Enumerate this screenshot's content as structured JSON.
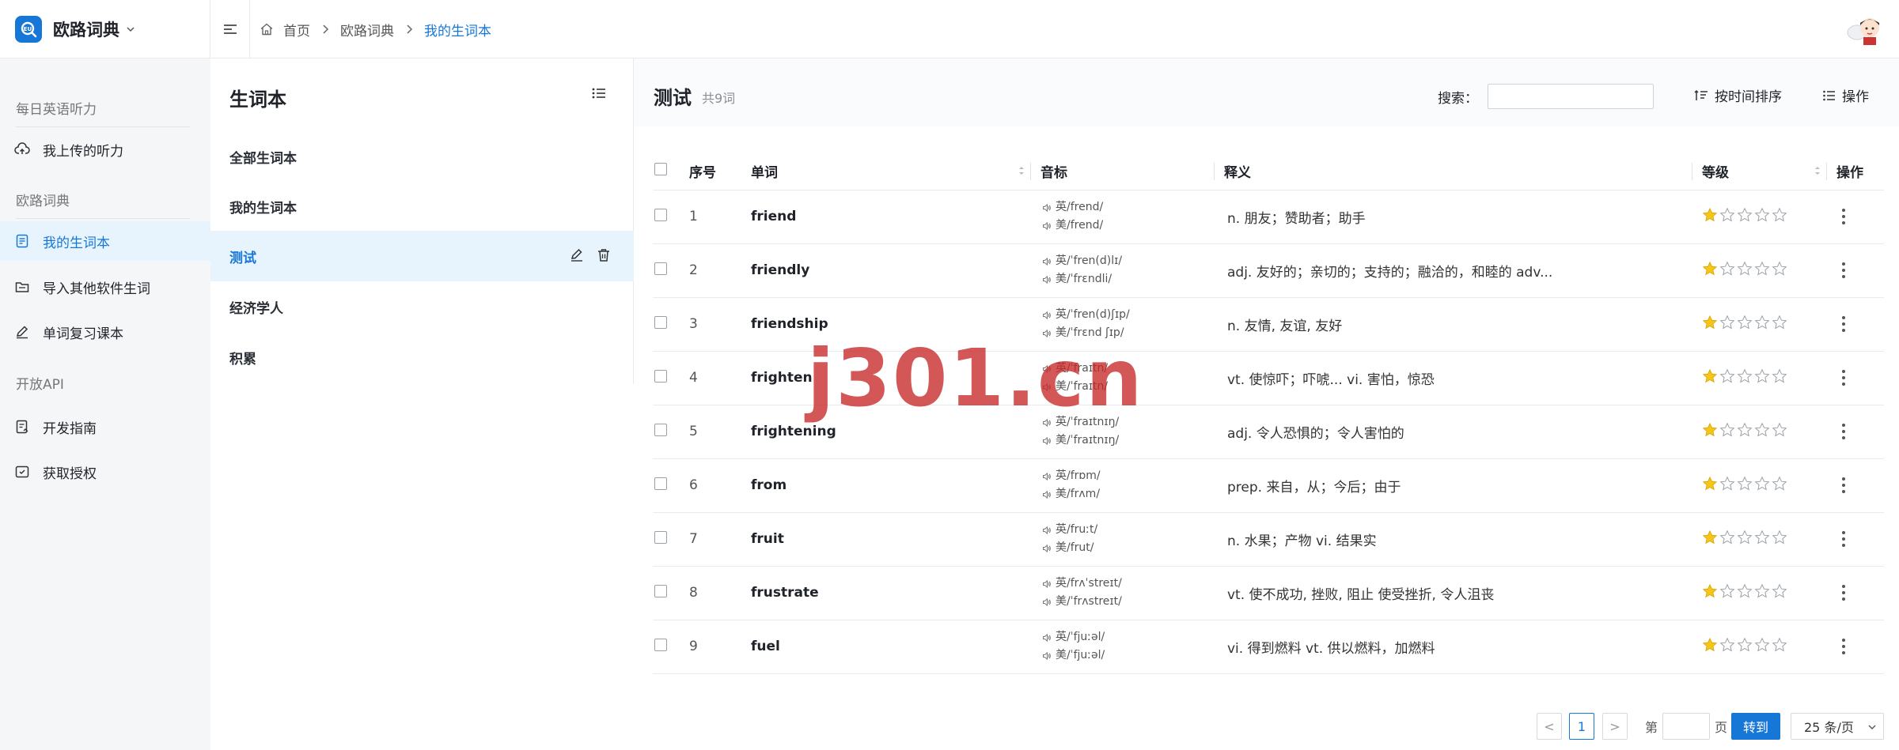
{
  "app": {
    "name": "欧路词典",
    "breadcrumb": [
      "首页",
      "欧路词典",
      "我的生词本"
    ]
  },
  "sidebar": {
    "groups": [
      {
        "title": "每日英语听力",
        "items": [
          {
            "label": "我上传的听力",
            "icon": "cloud-upload-icon"
          }
        ]
      },
      {
        "title": "欧路词典",
        "items": [
          {
            "label": "我的生词本",
            "icon": "notebook-icon",
            "active": true
          },
          {
            "label": "导入其他软件生词",
            "icon": "folder-icon"
          },
          {
            "label": "单词复习课本",
            "icon": "pencil-icon"
          }
        ]
      },
      {
        "title": "开放API",
        "items": [
          {
            "label": "开发指南",
            "icon": "doc-icon"
          },
          {
            "label": "获取授权",
            "icon": "auth-icon"
          }
        ]
      }
    ]
  },
  "notebooks": {
    "title": "生词本",
    "items": [
      "全部生词本",
      "我的生词本",
      "测试",
      "经济学人",
      "积累"
    ],
    "active_index": 2
  },
  "main": {
    "title": "测试",
    "count": "共9词",
    "search_label": "搜索：",
    "search_placeholder": "",
    "sort_label": "按时间排序",
    "ops_label": "操作",
    "columns": [
      "序号",
      "单词",
      "音标",
      "释义",
      "等级",
      "操作"
    ],
    "rows": [
      {
        "idx": "1",
        "word": "friend",
        "uk": "英/frend/",
        "us": "美/frend/",
        "def": "n. 朋友；赞助者；助手",
        "stars": 1
      },
      {
        "idx": "2",
        "word": "friendly",
        "uk": "英/ˈfren(d)lɪ/",
        "us": "美/ˈfrɛndli/",
        "def": "adj. 友好的；亲切的；支持的；融洽的，和睦的 adv...",
        "stars": 1
      },
      {
        "idx": "3",
        "word": "friendship",
        "uk": "英/ˈfren(d)ʃɪp/",
        "us": "美/ˈfrɛnd ʃɪp/",
        "def": "n. 友情, 友谊, 友好",
        "stars": 1
      },
      {
        "idx": "4",
        "word": "frighten",
        "uk": "英/ˈfraɪtn/",
        "us": "美/ˈfraɪtn/",
        "def": "vt. 使惊吓；吓唬... vi. 害怕，惊恐",
        "stars": 1
      },
      {
        "idx": "5",
        "word": "frightening",
        "uk": "英/ˈfraɪtnɪŋ/",
        "us": "美/ˈfraɪtnɪŋ/",
        "def": "adj. 令人恐惧的；令人害怕的",
        "stars": 1
      },
      {
        "idx": "6",
        "word": "from",
        "uk": "英/frɒm/",
        "us": "美/frʌm/",
        "def": "prep. 来自，从；今后；由于",
        "stars": 1
      },
      {
        "idx": "7",
        "word": "fruit",
        "uk": "英/fruːt/",
        "us": "美/frut/",
        "def": "n. 水果；产物 vi. 结果实",
        "stars": 1
      },
      {
        "idx": "8",
        "word": "frustrate",
        "uk": "英/frʌˈstreɪt/",
        "us": "美/ˈfrʌstreɪt/",
        "def": "vt. 使不成功, 挫败, 阻止 使受挫折, 令人沮丧",
        "stars": 1
      },
      {
        "idx": "9",
        "word": "fuel",
        "uk": "英/ˈfjuːəl/",
        "us": "美/ˈfjuːəl/",
        "def": "vi. 得到燃料 vt. 供以燃料，加燃料",
        "stars": 1
      }
    ],
    "max_stars": 5
  },
  "pagination": {
    "prev": "<",
    "next": ">",
    "current": "1",
    "goto_prefix": "第",
    "goto_suffix": "页",
    "goto_button": "转到",
    "page_size": "25 条/页"
  },
  "watermark": "j301.cn",
  "colors": {
    "accent": "#1677d6",
    "active_bg": "#e8f4fd",
    "star": "#f5c518"
  }
}
